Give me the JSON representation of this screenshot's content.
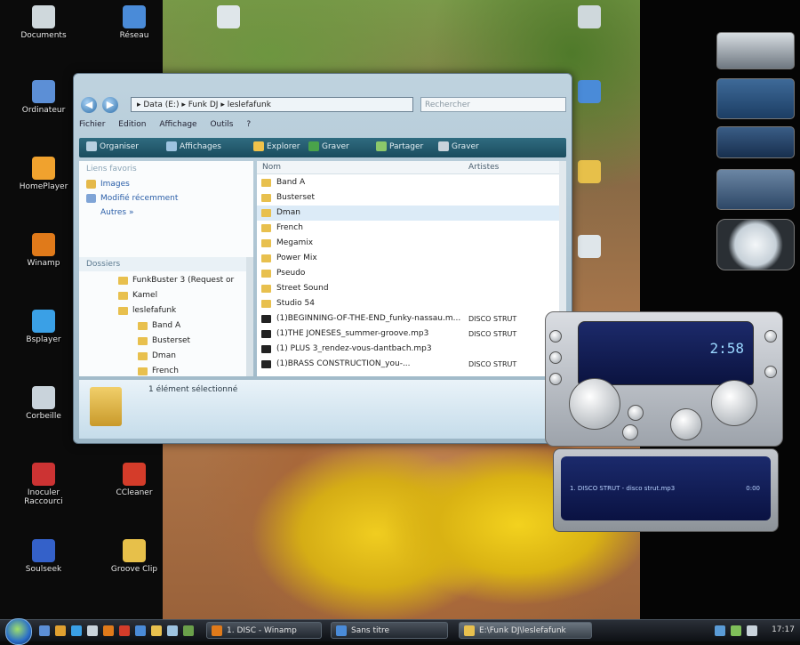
{
  "desktop_icons_left": [
    {
      "label": "Documents",
      "color": "#cfd8dc"
    },
    {
      "label": "Ordinateur",
      "color": "#5c8fd6"
    },
    {
      "label": "HomePlayer",
      "color": "#f0a22e"
    },
    {
      "label": "Winamp",
      "color": "#e07a1a"
    },
    {
      "label": "Bsplayer",
      "color": "#3aa0e6"
    },
    {
      "label": "Corbeille",
      "color": "#c9d3db"
    },
    {
      "label": "Inoculer Raccourci",
      "color": "#c33"
    },
    {
      "label": "Soulseek",
      "color": "#3461c9"
    }
  ],
  "desktop_icons_left2": [
    {
      "label": "Réseau",
      "color": "#4a8bd8"
    },
    {
      "label": "CCleaner",
      "color": "#d43c2a"
    },
    {
      "label": "Groove Clip",
      "color": "#e7c04a"
    }
  ],
  "explorer": {
    "address": "▸ Data (E:) ▸ Funk DJ ▸ leslefafunk",
    "search_placeholder": "Rechercher",
    "menu": [
      "Fichier",
      "Edition",
      "Affichage",
      "Outils",
      "?"
    ],
    "toolbar": [
      "Organiser",
      "Affichages",
      "Explorer",
      "Graver",
      "Partager",
      "Graver"
    ],
    "nav": {
      "header": "Liens favoris",
      "links": [
        "Images",
        "Modifié récemment",
        "Autres »"
      ],
      "folders_header": "Dossiers"
    },
    "tree": [
      {
        "label": "FunkBuster 3 (Request or",
        "indent": 2
      },
      {
        "label": "Kamel",
        "indent": 2
      },
      {
        "label": "leslefafunk",
        "indent": 2
      },
      {
        "label": "Band A",
        "indent": 3
      },
      {
        "label": "Busterset",
        "indent": 3
      },
      {
        "label": "Dman",
        "indent": 3
      },
      {
        "label": "French",
        "indent": 3
      }
    ],
    "columns": {
      "name": "Nom",
      "artist": "Artistes"
    },
    "files": [
      {
        "name": "Band A",
        "type": "folder",
        "artist": ""
      },
      {
        "name": "Busterset",
        "type": "folder",
        "artist": ""
      },
      {
        "name": "Dman",
        "type": "folder",
        "artist": "",
        "selected": true
      },
      {
        "name": "French",
        "type": "folder",
        "artist": ""
      },
      {
        "name": "Megamix",
        "type": "folder",
        "artist": ""
      },
      {
        "name": "Power Mix",
        "type": "folder",
        "artist": ""
      },
      {
        "name": "Pseudo",
        "type": "folder",
        "artist": ""
      },
      {
        "name": "Street Sound",
        "type": "folder",
        "artist": ""
      },
      {
        "name": "Studio 54",
        "type": "folder",
        "artist": ""
      },
      {
        "name": "(1)BEGINNING-OF-THE-END_funky-nassau.m...",
        "type": "mp3",
        "artist": "DISCO STRUT"
      },
      {
        "name": "(1)THE JONESES_summer-groove.mp3",
        "type": "mp3",
        "artist": "DISCO STRUT"
      },
      {
        "name": "(1) PLUS 3_rendez-vous-dantbach.mp3",
        "type": "mp3",
        "artist": ""
      },
      {
        "name": "(1)BRASS CONSTRUCTION_you-...",
        "type": "mp3",
        "artist": "DISCO STRUT"
      }
    ],
    "details": "1 élément sélectionné"
  },
  "player": {
    "time": "2:58",
    "playlist_entry": "1. DISCO STRUT - disco strut.mp3",
    "playlist_duration": "0:00"
  },
  "taskbar": {
    "tasks": [
      {
        "label": "1. DISC - Winamp",
        "color": "#e07a1a"
      },
      {
        "label": "Sans titre",
        "color": "#4a8bd8"
      },
      {
        "label": "E:\\Funk DJ\\leslefafunk",
        "color": "#e8c04e"
      }
    ],
    "clock": "17:17"
  }
}
